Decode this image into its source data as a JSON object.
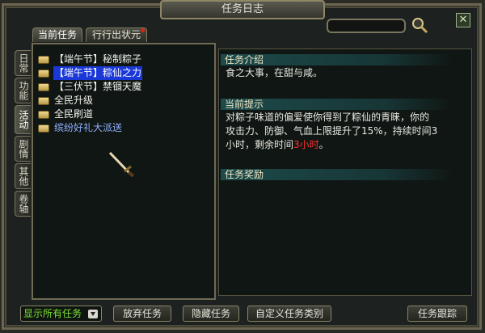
{
  "window": {
    "title": "任务日志"
  },
  "tabs": [
    {
      "label": "当前任务",
      "active": true
    },
    {
      "label": "行行出状元",
      "active": false,
      "has_alert": true
    }
  ],
  "category_tabs": [
    {
      "label": "日常",
      "active": false
    },
    {
      "label": "功能",
      "active": false
    },
    {
      "label": "活动",
      "active": true
    },
    {
      "label": "剧情",
      "active": false
    },
    {
      "label": "其他",
      "active": false
    },
    {
      "label": "卷轴",
      "active": false
    }
  ],
  "quests": [
    {
      "label": "【端午节】秘制粽子",
      "state": "normal"
    },
    {
      "label": "【端午节】粽仙之力",
      "state": "selected"
    },
    {
      "label": "【三伏节】禁锢天魔",
      "state": "normal"
    },
    {
      "label": "全民升级",
      "state": "normal"
    },
    {
      "label": "全民刷道",
      "state": "normal"
    },
    {
      "label": "缤纷好礼大派送",
      "state": "link"
    }
  ],
  "detail": {
    "intro_heading": "任务介绍",
    "intro_text": "食之大事，在甜与咸。",
    "hint_heading": "当前提示",
    "hint_line1": "对粽子味道的偏爱使你得到了粽仙的青睐，你的",
    "hint_line2": "攻击力、防御、气血上限提升了15%，持续时间3",
    "hint_line3a": "小时，剩余时间",
    "hint_time": "3小时",
    "hint_line3b": "。",
    "reward_heading": "任务奖励"
  },
  "bottom": {
    "filter_value": "显示所有任务",
    "abandon_label": "放弃任务",
    "hide_label": "隐藏任务",
    "custom_label": "自定义任务类别",
    "track_label": "任务跟踪"
  },
  "colors": {
    "selected_bg": "#1a38d8",
    "link": "#8fb0ff",
    "filter_text": "#7ce030",
    "time_warning": "#ff3030",
    "section_head": "#1d4a4a"
  }
}
